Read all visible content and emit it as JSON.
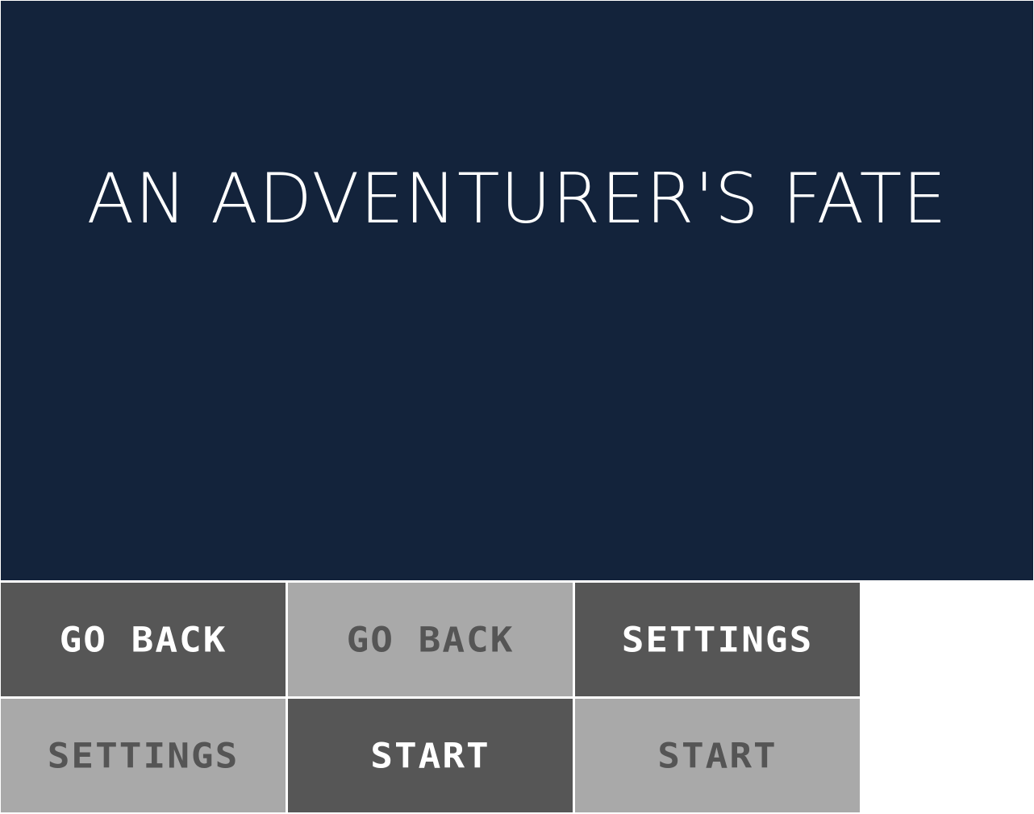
{
  "title": "AN ADVENTURER'S FATE",
  "colors": {
    "title_background": "#13233b",
    "button_dark": "#565656",
    "button_light": "#a9a9a9",
    "text_on_dark": "#ffffff",
    "text_on_light": "#555555"
  },
  "buttons": [
    {
      "label": "GO BACK",
      "state": "normal"
    },
    {
      "label": "GO BACK",
      "state": "hover"
    },
    {
      "label": "SETTINGS",
      "state": "normal"
    },
    {
      "label": "SETTINGS",
      "state": "hover"
    },
    {
      "label": "START",
      "state": "normal"
    },
    {
      "label": "START",
      "state": "hover"
    }
  ]
}
